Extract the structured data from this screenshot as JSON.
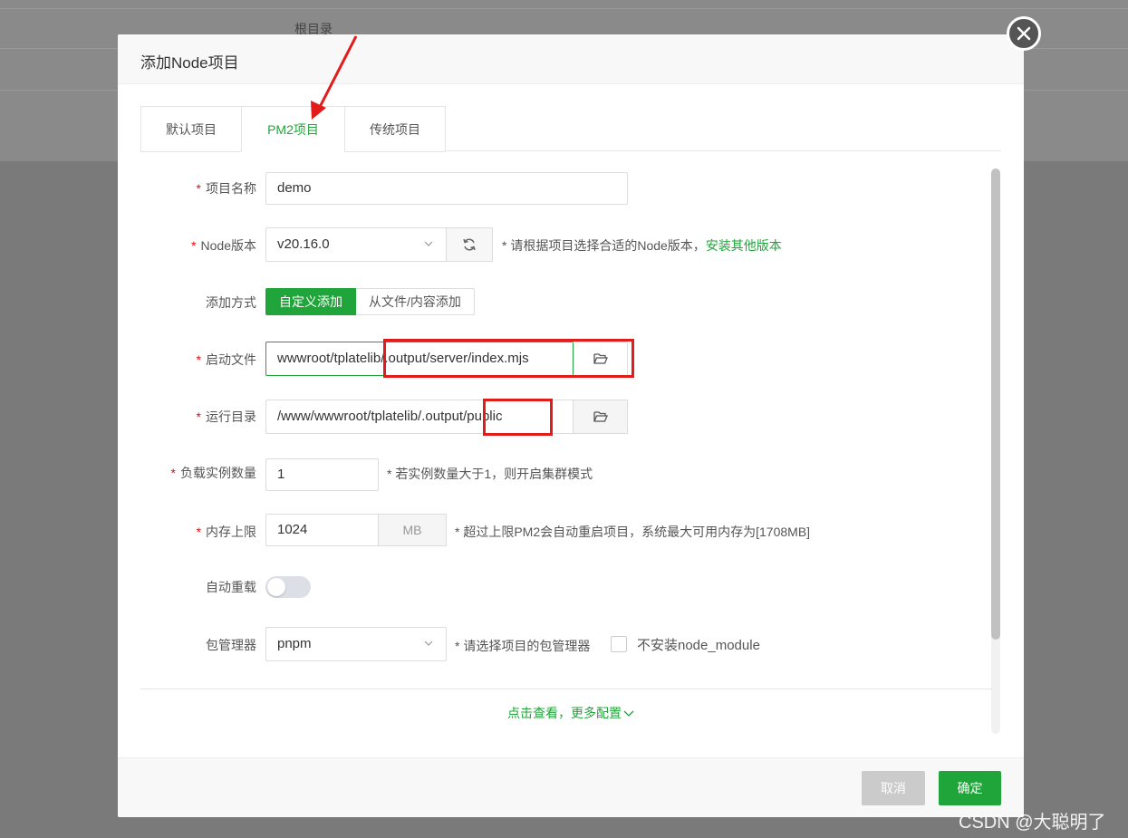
{
  "background": {
    "column_header": "根目录"
  },
  "dialog": {
    "title": "添加Node项目",
    "tabs": [
      {
        "label": "默认项目",
        "active": false
      },
      {
        "label": "PM2项目",
        "active": true
      },
      {
        "label": "传统项目",
        "active": false
      }
    ],
    "form": {
      "project_name": {
        "label": "项目名称",
        "required": true,
        "value": "demo"
      },
      "node_version": {
        "label": "Node版本",
        "required": true,
        "value": "v20.16.0",
        "hint": "* 请根据项目选择合适的Node版本，",
        "hint_link": "安装其他版本"
      },
      "add_method": {
        "label": "添加方式",
        "options": [
          "自定义添加",
          "从文件/内容添加"
        ],
        "selected": "自定义添加"
      },
      "start_file": {
        "label": "启动文件",
        "required": true,
        "value": "wwwroot/tplatelib/.output/server/index.mjs"
      },
      "run_dir": {
        "label": "运行目录",
        "required": true,
        "value": "/www/wwwroot/tplatelib/.output/public"
      },
      "instances": {
        "label": "负载实例数量",
        "required": true,
        "value": "1",
        "hint": "* 若实例数量大于1，则开启集群模式"
      },
      "memory": {
        "label": "内存上限",
        "required": true,
        "value": "1024",
        "unit": "MB",
        "hint": "* 超过上限PM2会自动重启项目，系统最大可用内存为[1708MB]"
      },
      "auto_reload": {
        "label": "自动重载",
        "enabled": false
      },
      "package_manager": {
        "label": "包管理器",
        "value": "pnpm",
        "hint": "* 请选择项目的包管理器",
        "checkbox_label": "不安装node_module",
        "checkbox_checked": false
      }
    },
    "more_config": "点击查看，更多配置",
    "buttons": {
      "cancel": "取消",
      "confirm": "确定"
    }
  },
  "watermark": "CSDN @大聪明了",
  "colors": {
    "accent": "#20a53a",
    "required": "#ef0808",
    "annotation": "#e21b1b"
  },
  "icons": [
    "close-icon",
    "refresh-icon",
    "folder-open-icon",
    "chevron-down-icon",
    "annotation-arrow"
  ]
}
